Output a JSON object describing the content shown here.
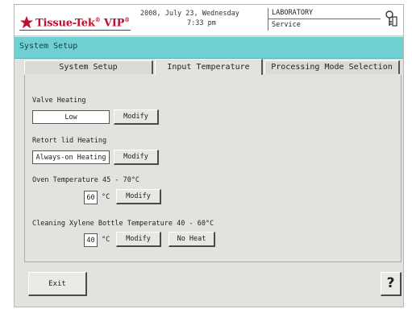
{
  "header": {
    "logo_text": "Tissue-Tek",
    "logo_suffix": " VIP",
    "date_line": "2008, July 23, Wednesday",
    "time_line": "7:33 pm",
    "user_role": "LABORATORY",
    "user_level": "Service",
    "brand_color": "#c0102f"
  },
  "titlebar": {
    "title": "System Setup",
    "color": "#6fd0d4"
  },
  "tabs": [
    {
      "label": "System Setup",
      "active": false
    },
    {
      "label": "Input Temperature",
      "active": true
    },
    {
      "label": "Processing Mode Selection",
      "active": false
    }
  ],
  "settings": {
    "valve_heating": {
      "label": "Valve Heating",
      "value": "Low",
      "modify_label": "Modify"
    },
    "retort_lid_heating": {
      "label": "Retort lid Heating",
      "value": "Always-on Heating",
      "modify_label": "Modify"
    },
    "oven_temperature": {
      "label": "Oven Temperature  45 - 70°C",
      "value": "60",
      "unit": "°C",
      "modify_label": "Modify"
    },
    "cleaning_xylene": {
      "label": "Cleaning Xylene Bottle Temperature  40 - 60°C",
      "value": "40",
      "unit": "°C",
      "modify_label": "Modify",
      "no_heat_label": "No Heat"
    }
  },
  "footer": {
    "exit_label": "Exit",
    "help_label": "?"
  },
  "icons": {
    "logo": "star-logo-icon",
    "user": "keys-icon"
  }
}
